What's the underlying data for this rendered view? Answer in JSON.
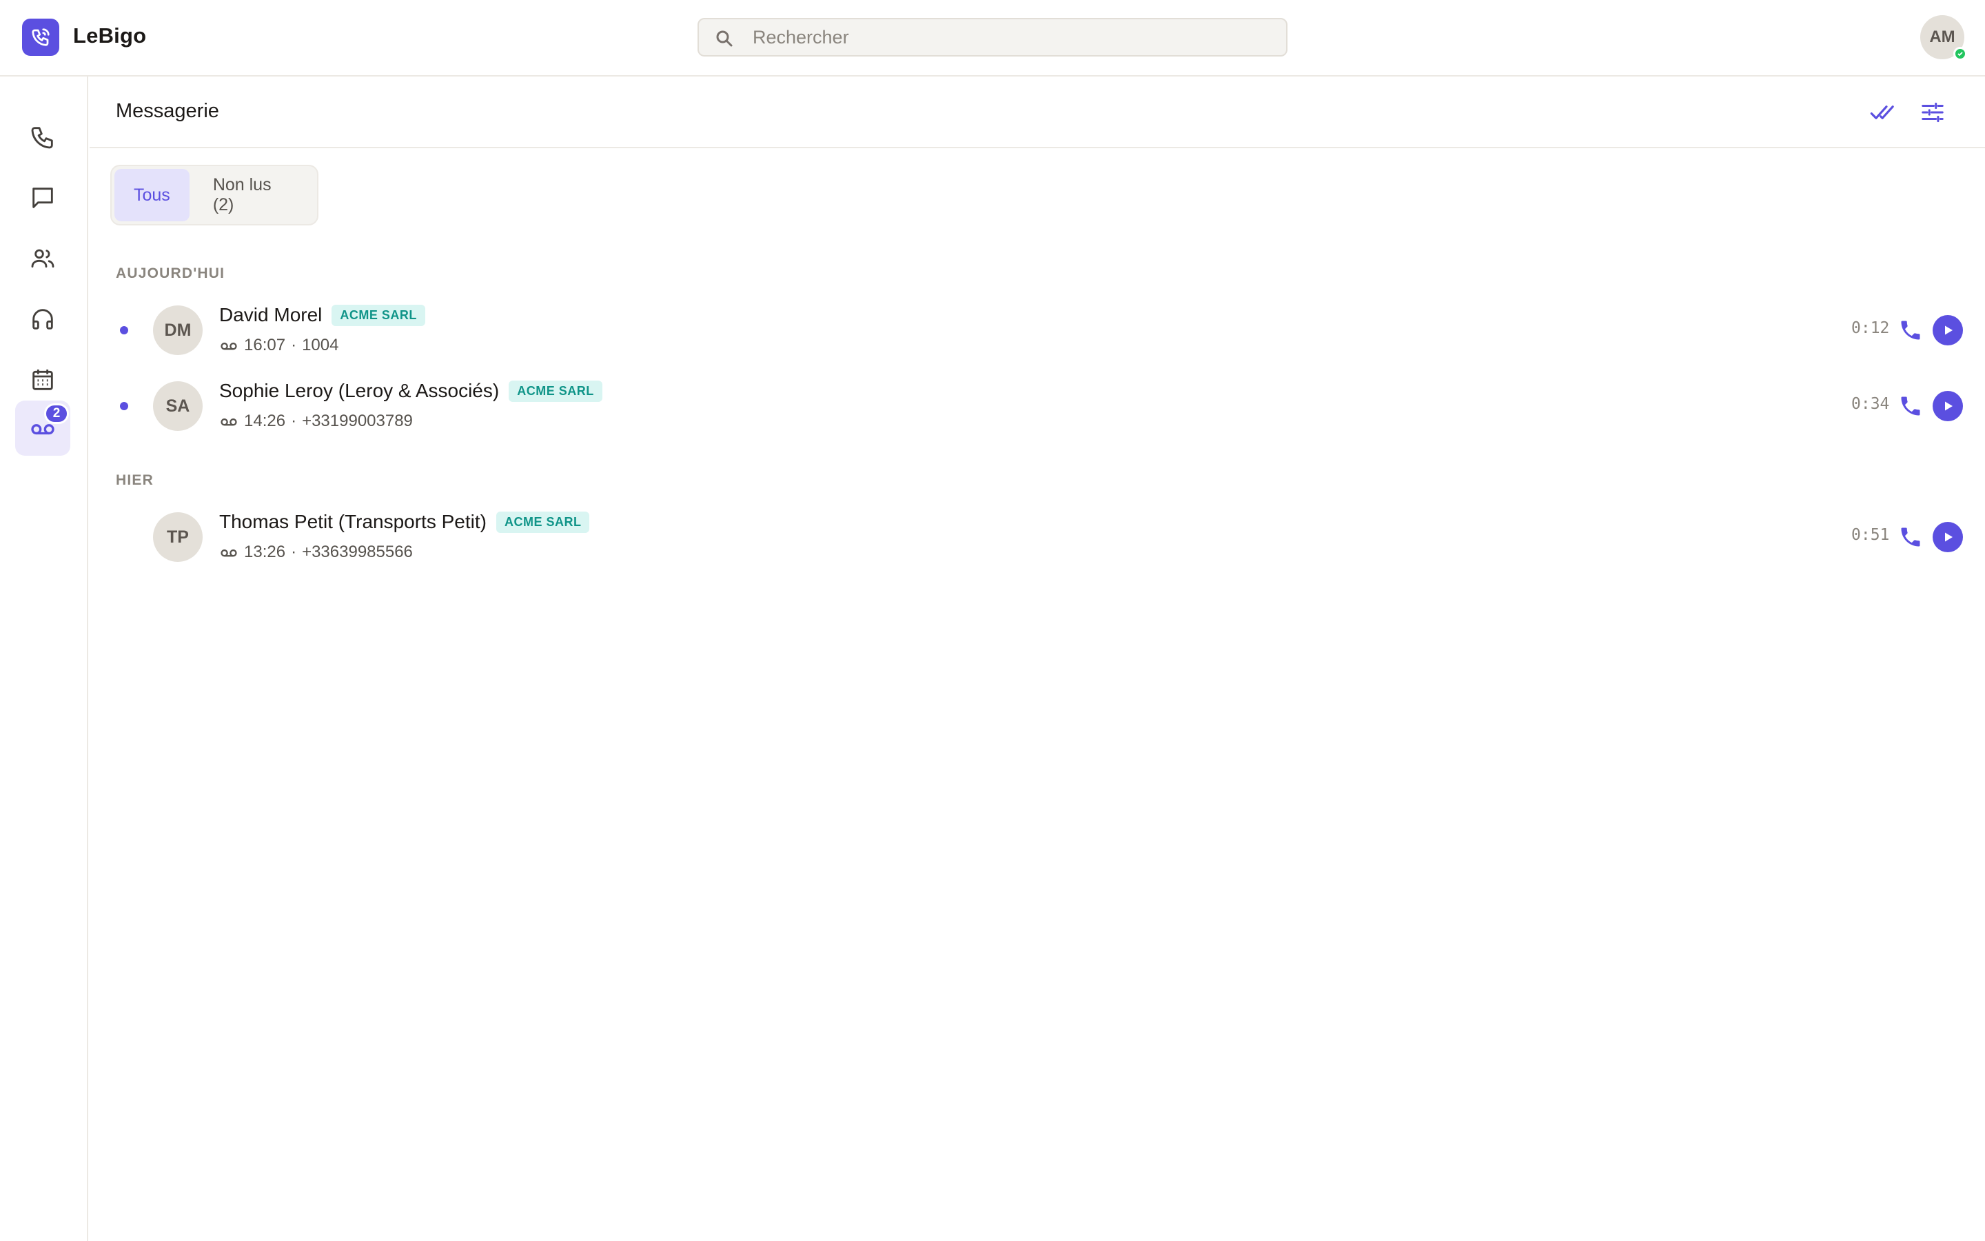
{
  "app": {
    "name": "LeBigo"
  },
  "search": {
    "placeholder": "Rechercher"
  },
  "user": {
    "initials": "AM",
    "status_color": "#22c55e"
  },
  "colors": {
    "accent": "#5b4fe0",
    "tag_text": "#0f9488",
    "tag_bg": "#d9f5f2"
  },
  "sidebar": {
    "items": [
      {
        "name": "calls",
        "icon": "phone-icon"
      },
      {
        "name": "messages",
        "icon": "chat-icon"
      },
      {
        "name": "contacts",
        "icon": "users-icon"
      },
      {
        "name": "support",
        "icon": "headset-icon"
      },
      {
        "name": "calendar",
        "icon": "calendar-icon"
      },
      {
        "name": "voicemail",
        "icon": "voicemail-icon",
        "badge": "2",
        "active": true
      }
    ]
  },
  "main": {
    "title": "Messagerie",
    "actions": [
      {
        "name": "mark-all-read",
        "icon": "double-check-icon"
      },
      {
        "name": "filters",
        "icon": "sliders-icon"
      }
    ],
    "tabs": [
      {
        "label": "Tous",
        "active": true
      },
      {
        "label": "Non lus (2)",
        "active": false
      }
    ],
    "groups": [
      {
        "label": "AUJOURD'HUI",
        "items": [
          {
            "initials": "DM",
            "name": "David Morel",
            "tag": "ACME SARL",
            "time": "16:07",
            "number": "1004",
            "duration": "0:12",
            "unread": true
          },
          {
            "initials": "SA",
            "name": "Sophie Leroy (Leroy & Associés)",
            "tag": "ACME SARL",
            "time": "14:26",
            "number": "+33199003789",
            "duration": "0:34",
            "unread": true
          }
        ]
      },
      {
        "label": "HIER",
        "items": [
          {
            "initials": "TP",
            "name": "Thomas Petit (Transports Petit)",
            "tag": "ACME SARL",
            "time": "13:26",
            "number": "+33639985566",
            "duration": "0:51",
            "unread": false
          }
        ]
      }
    ]
  }
}
